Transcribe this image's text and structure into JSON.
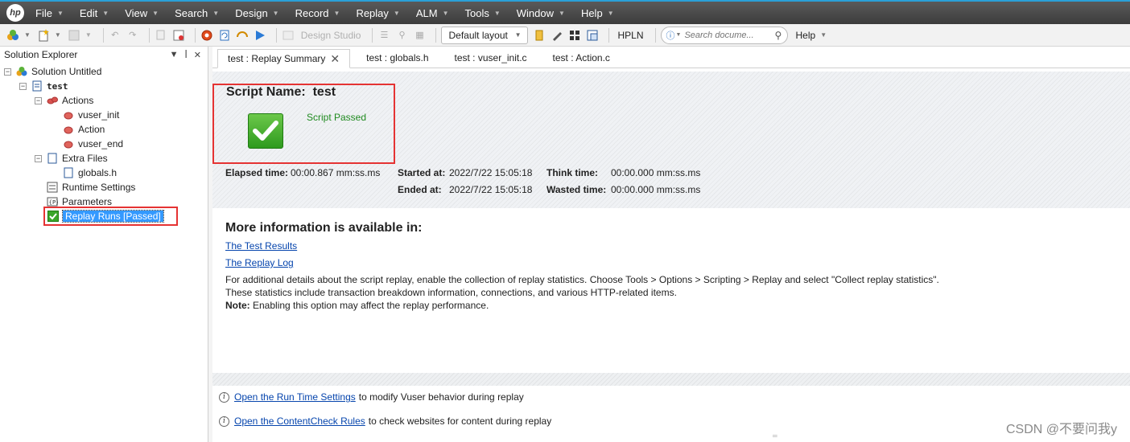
{
  "menu": [
    "File",
    "Edit",
    "View",
    "Search",
    "Design",
    "Record",
    "Replay",
    "ALM",
    "Tools",
    "Window",
    "Help"
  ],
  "toolbar": {
    "design_studio": "Design Studio",
    "layout": "Default layout",
    "hpln": "HPLN",
    "search_placeholder": "Search docume...",
    "help": "Help"
  },
  "solution_explorer": {
    "title": "Solution Explorer",
    "solution": "Solution Untitled",
    "script": "test",
    "actions_folder": "Actions",
    "actions": [
      "vuser_init",
      "Action",
      "vuser_end"
    ],
    "extra_folder": "Extra Files",
    "extra_files": [
      "globals.h"
    ],
    "runtime_settings": "Runtime Settings",
    "parameters": "Parameters",
    "replay_runs": "Replay Runs [Passed]"
  },
  "tabs": [
    {
      "label": "test : Replay Summary",
      "active": true
    },
    {
      "label": "test : globals.h",
      "active": false
    },
    {
      "label": "test : vuser_init.c",
      "active": false
    },
    {
      "label": "test : Action.c",
      "active": false
    }
  ],
  "summary": {
    "script_name_label": "Script Name:",
    "script_name": "test",
    "status": "Script Passed",
    "elapsed_label": "Elapsed time:",
    "elapsed_value": "00:00.867 mm:ss.ms",
    "started_label": "Started at:",
    "started_value": "2022/7/22 15:05:18",
    "ended_label": "Ended at:",
    "ended_value": "2022/7/22 15:05:18",
    "think_label": "Think time:",
    "think_value": "00:00.000 mm:ss.ms",
    "wasted_label": "Wasted time:",
    "wasted_value": "00:00.000 mm:ss.ms"
  },
  "more_info": {
    "title": "More information is available in:",
    "link_results": "The Test Results",
    "link_log": "The Replay Log",
    "line1": "For additional details about the script replay, enable the collection of replay statistics. Choose Tools > Options > Scripting > Replay and select \"Collect replay statistics\".",
    "line2": "These statistics include transaction breakdown information, connections, and various HTTP-related items.",
    "note_label": "Note:",
    "note_text": " Enabling this option may affect the replay performance."
  },
  "tips": {
    "runtime_link": "Open the Run Time Settings",
    "runtime_text": "to modify Vuser behavior during replay",
    "content_link": "Open the ContentCheck Rules",
    "content_text": "to check websites for content during replay"
  },
  "watermark": "CSDN @不要问我y",
  "colors": {
    "accent_blue": "#3399ff",
    "highlight_red": "#e53333",
    "passed_green": "#1f8a1f",
    "link": "#0645ad"
  }
}
